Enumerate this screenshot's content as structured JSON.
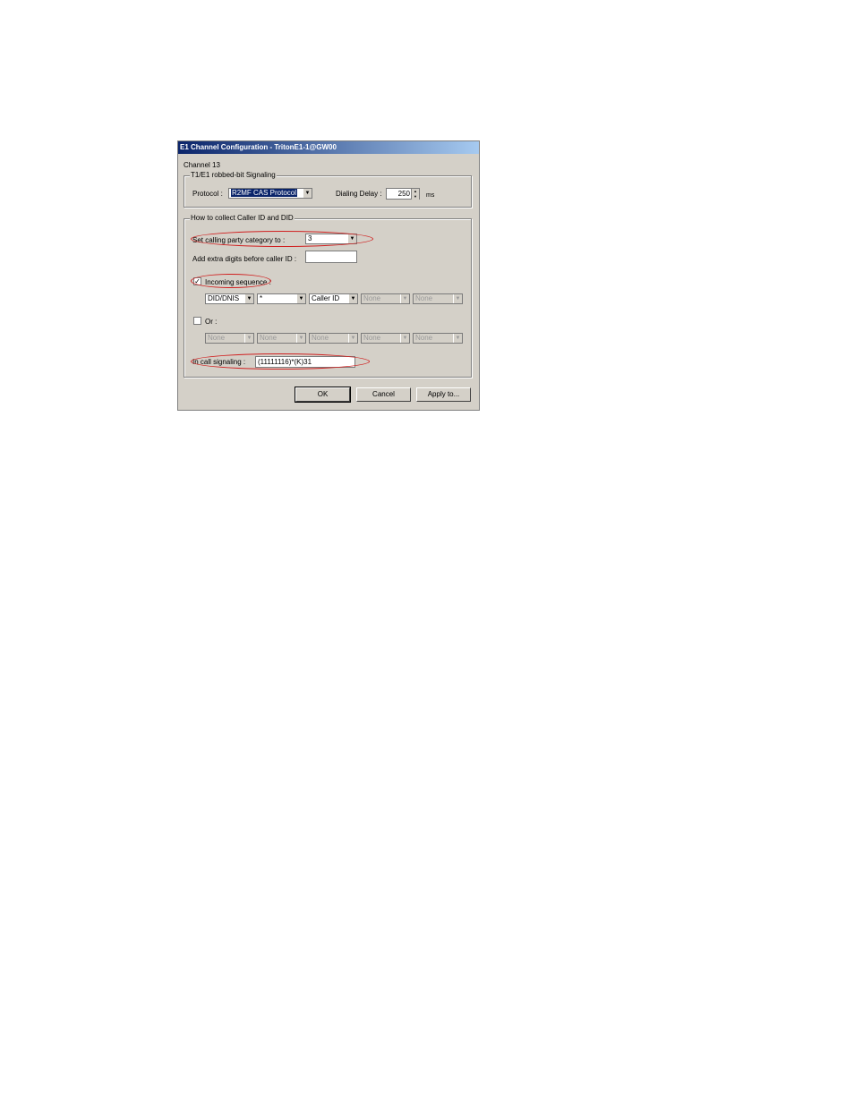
{
  "dialog": {
    "title": "E1 Channel Configuration - TritonE1-1@GW00",
    "channel_label": "Channel 13"
  },
  "signaling_group": {
    "title": "T1/E1 robbed-bit Signaling",
    "protocol_label": "Protocol :",
    "protocol_value": "R2MF CAS Protocol",
    "dialing_delay_label": "Dialing Delay :",
    "dialing_delay_value": "250",
    "dialing_delay_unit": "ms"
  },
  "collect_group": {
    "title": "How to collect Caller ID and DID",
    "calling_party_label": "Set calling party category to :",
    "calling_party_value": "3",
    "extra_digits_label": "Add extra digits before caller ID :",
    "extra_digits_value": "",
    "incoming_sequence_label": "Incoming sequence :",
    "incoming_sequence_checked": "✓",
    "incoming_sequence_combos": [
      "DID/DNIS",
      "*",
      "Caller ID",
      "None",
      "None"
    ],
    "or_label": "Or :",
    "or_combos": [
      "None",
      "None",
      "None",
      "None",
      "None"
    ],
    "call_signaling_label": "In call signaling :",
    "call_signaling_value": "(11111116)*(K)31"
  },
  "buttons": {
    "ok": "OK",
    "cancel": "Cancel",
    "apply": "Apply to..."
  },
  "colors": {
    "annotation": "#d02020",
    "titlebar_start": "#0a246a",
    "dialog_bg": "#d4d0c8"
  }
}
